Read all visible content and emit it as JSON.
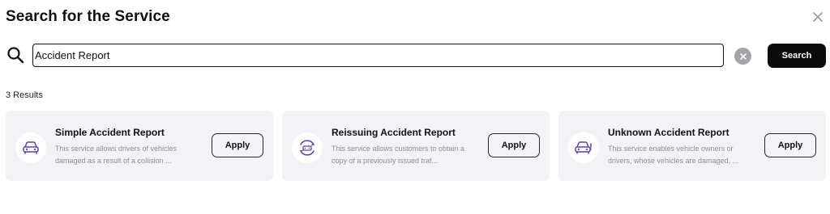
{
  "dialog": {
    "title": "Search for the Service",
    "close_icon": "close-icon"
  },
  "search": {
    "value": "Accident Report",
    "icon": "search-icon",
    "clear_icon": "clear-circle-icon",
    "button_label": "Search"
  },
  "results": {
    "count_label": "3 Results",
    "items": [
      {
        "title": "Simple Accident Report",
        "description": "This service allows drivers of vehicles damaged as a result of a collision ...",
        "apply_label": "Apply",
        "icon": "car-icon"
      },
      {
        "title": "Reissuing Accident Report",
        "description": "This service allows customers to obtain a copy of a previously issued traf...",
        "apply_label": "Apply",
        "icon": "car-refresh-icon"
      },
      {
        "title": "Unknown Accident Report",
        "description": "This service enables vehicle owners or drivers, whose vehicles are damaged, ...",
        "apply_label": "Apply",
        "icon": "car-alert-icon"
      }
    ]
  },
  "colors": {
    "accent_icon": "#5b3fbf",
    "card_background": "#f3f3f7",
    "primary_button": "#0b0b0b"
  }
}
